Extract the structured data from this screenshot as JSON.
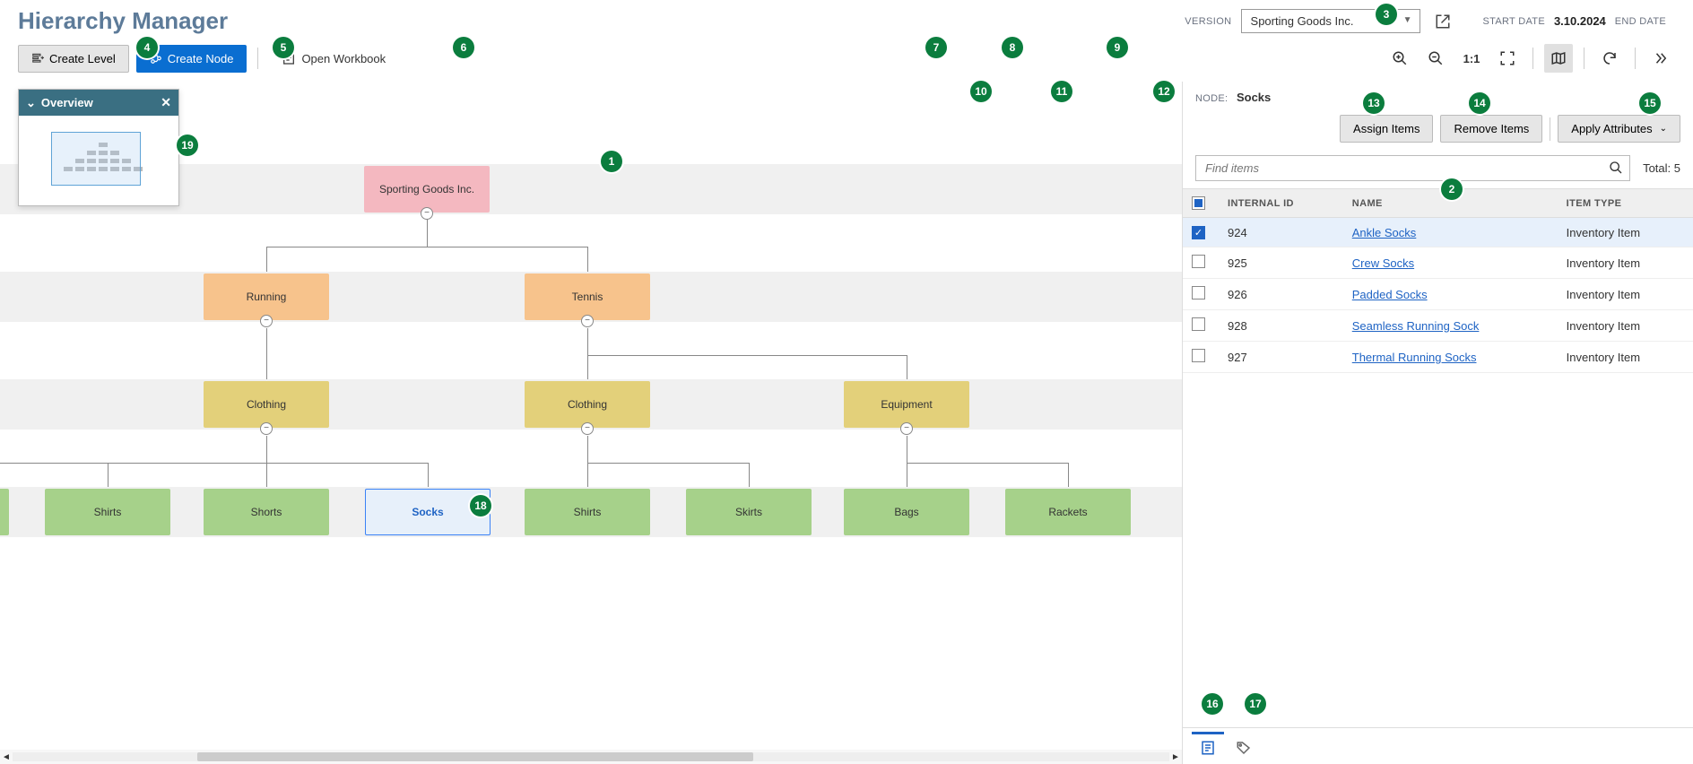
{
  "title": "Hierarchy Manager",
  "version": {
    "label": "VERSION",
    "value": "Sporting Goods Inc."
  },
  "dates": {
    "start_label": "START DATE",
    "start_value": "3.10.2024",
    "end_label": "END DATE",
    "end_value": ""
  },
  "toolbar": {
    "create_level": "Create Level",
    "create_node": "Create Node",
    "open_workbook": "Open Workbook",
    "ratio": "1:1"
  },
  "overview": {
    "title": "Overview"
  },
  "tree": {
    "root": "Sporting Goods Inc.",
    "cats": [
      "Running",
      "Tennis"
    ],
    "subs_running": [
      "Clothing"
    ],
    "subs_tennis": [
      "Clothing",
      "Equipment"
    ],
    "leaves_running_clothing": [
      "Shirts",
      "Shorts",
      "Socks"
    ],
    "leaves_tennis_clothing": [
      "Shirts",
      "Skirts"
    ],
    "leaves_tennis_equipment": [
      "Bags",
      "Rackets"
    ]
  },
  "side": {
    "node_label": "NODE:",
    "node_value": "Socks",
    "assign_items": "Assign Items",
    "remove_items": "Remove Items",
    "apply_attributes": "Apply Attributes",
    "search_placeholder": "Find items",
    "total_label": "Total: 5",
    "columns": {
      "id": "INTERNAL ID",
      "name": "NAME",
      "type": "ITEM TYPE"
    },
    "rows": [
      {
        "checked": true,
        "id": "924",
        "name": "Ankle Socks",
        "type": "Inventory Item"
      },
      {
        "checked": false,
        "id": "925",
        "name": "Crew Socks",
        "type": "Inventory Item"
      },
      {
        "checked": false,
        "id": "926",
        "name": "Padded Socks",
        "type": "Inventory Item"
      },
      {
        "checked": false,
        "id": "928",
        "name": "Seamless Running Sock",
        "type": "Inventory Item"
      },
      {
        "checked": false,
        "id": "927",
        "name": "Thermal Running Socks",
        "type": "Inventory Item"
      }
    ]
  },
  "callouts": [
    "1",
    "2",
    "3",
    "4",
    "5",
    "6",
    "7",
    "8",
    "9",
    "10",
    "11",
    "12",
    "13",
    "14",
    "15",
    "16",
    "17",
    "18",
    "19"
  ]
}
